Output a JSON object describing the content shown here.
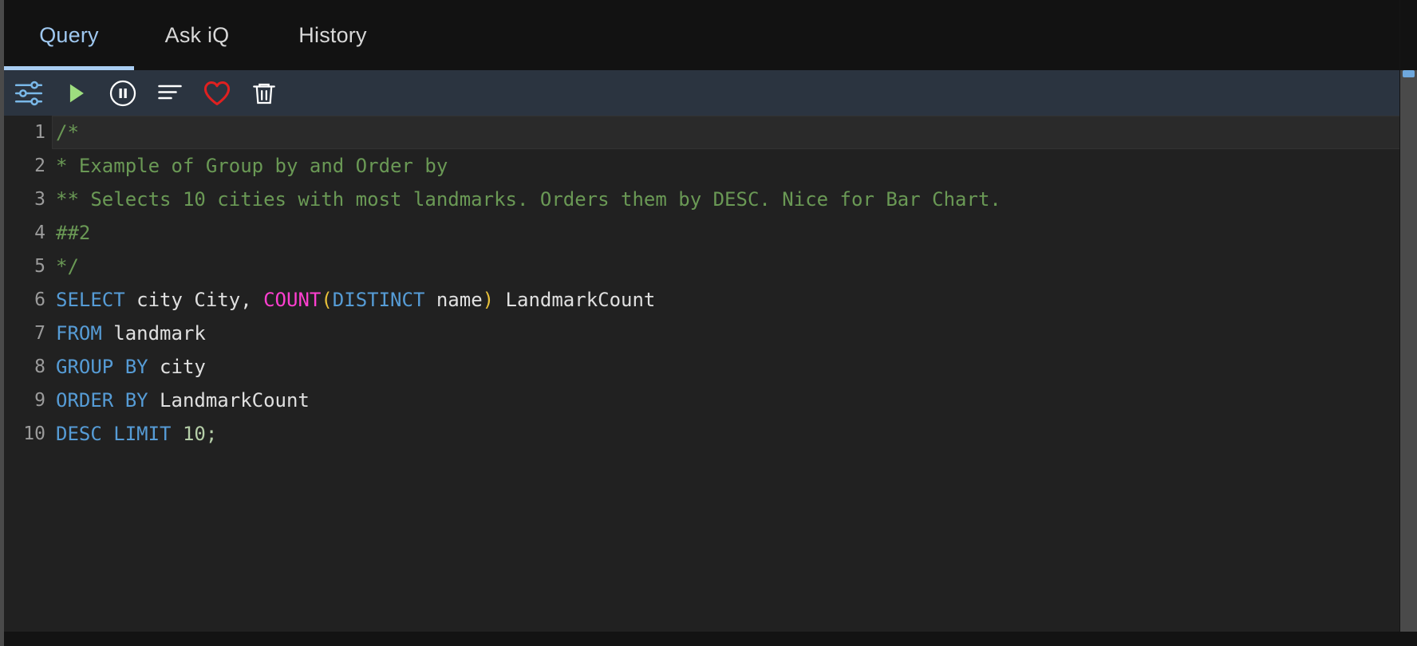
{
  "tabs": [
    {
      "id": "query",
      "label": "Query",
      "active": true
    },
    {
      "id": "askiq",
      "label": "Ask iQ",
      "active": false
    },
    {
      "id": "history",
      "label": "History",
      "active": false
    }
  ],
  "toolbar": {
    "buttons": [
      {
        "icon": "settings-sliders-icon",
        "label": "Settings",
        "color": "#7ab8e8"
      },
      {
        "icon": "play-icon",
        "label": "Run",
        "color": "#9ede7f"
      },
      {
        "icon": "pause-circle-icon",
        "label": "Pause",
        "color": "#ffffff"
      },
      {
        "icon": "format-lines-icon",
        "label": "Format",
        "color": "#ffffff"
      },
      {
        "icon": "heart-icon",
        "label": "Favorite",
        "color": "#e02020"
      },
      {
        "icon": "trash-icon",
        "label": "Delete",
        "color": "#ffffff"
      }
    ]
  },
  "editor": {
    "language": "sql",
    "active_line": 1,
    "line_count": 10,
    "plain_text": "/*\n* Example of Group by and Order by\n** Selects 10 cities with most landmarks. Orders them by DESC. Nice for Bar Chart.\n##2\n*/\nSELECT city City, COUNT(DISTINCT name) LandmarkCount\nFROM landmark\nGROUP BY city\nORDER BY LandmarkCount\nDESC LIMIT 10;",
    "lines": [
      {
        "n": "1",
        "tokens": [
          {
            "t": "/*",
            "c": "comment"
          }
        ]
      },
      {
        "n": "2",
        "tokens": [
          {
            "t": "* Example of Group by and Order by",
            "c": "comment"
          }
        ]
      },
      {
        "n": "3",
        "tokens": [
          {
            "t": "** Selects 10 cities with most landmarks. Orders them by DESC. Nice for Bar Chart.",
            "c": "comment"
          }
        ]
      },
      {
        "n": "4",
        "tokens": [
          {
            "t": "##2",
            "c": "comment"
          }
        ]
      },
      {
        "n": "5",
        "tokens": [
          {
            "t": "*/",
            "c": "comment"
          }
        ]
      },
      {
        "n": "6",
        "tokens": [
          {
            "t": "SELECT",
            "c": "keyword"
          },
          {
            "t": " city City, ",
            "c": "plain"
          },
          {
            "t": "COUNT",
            "c": "func"
          },
          {
            "t": "(",
            "c": "paren"
          },
          {
            "t": "DISTINCT",
            "c": "keyword"
          },
          {
            "t": " name",
            "c": "plain"
          },
          {
            "t": ")",
            "c": "paren"
          },
          {
            "t": " LandmarkCount",
            "c": "plain"
          }
        ]
      },
      {
        "n": "7",
        "tokens": [
          {
            "t": "FROM",
            "c": "keyword"
          },
          {
            "t": " landmark",
            "c": "plain"
          }
        ]
      },
      {
        "n": "8",
        "tokens": [
          {
            "t": "GROUP BY",
            "c": "keyword"
          },
          {
            "t": " city",
            "c": "plain"
          }
        ]
      },
      {
        "n": "9",
        "tokens": [
          {
            "t": "ORDER BY",
            "c": "keyword"
          },
          {
            "t": " LandmarkCount",
            "c": "plain"
          }
        ]
      },
      {
        "n": "10",
        "tokens": [
          {
            "t": "DESC LIMIT",
            "c": "keyword"
          },
          {
            "t": " ",
            "c": "plain"
          },
          {
            "t": "10;",
            "c": "number"
          }
        ]
      }
    ]
  },
  "colors": {
    "tab_active": "#9fc8f0",
    "tab_underline": "#a9cdf2",
    "toolbar_bg": "#2b3440",
    "editor_bg": "#212121",
    "comment": "#6a9955",
    "keyword": "#569cd6",
    "function": "#ff3fd0",
    "paren": "#e8c13a",
    "number": "#b5cea8",
    "scrollbar": "#4a4a4a"
  }
}
